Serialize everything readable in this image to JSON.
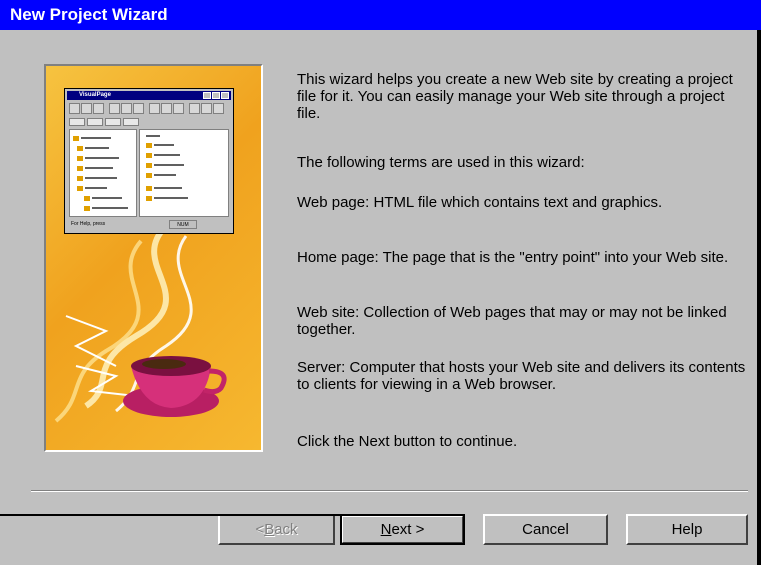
{
  "window": {
    "title": "New Project Wizard"
  },
  "illustration": {
    "mini_app_title": "VisualPage",
    "status_text": "For Help, press",
    "status_box": "NUM"
  },
  "content": {
    "intro": "This wizard helps you create a new Web site by creating a project file for it. You can easily manage your Web site through a project file.",
    "terms_intro": "The following terms are used in this wizard:",
    "term_web_page": "Web page:  HTML file which contains text and graphics.",
    "term_home_page": "Home page:  The page that is the \"entry point\" into your Web site.",
    "term_web_site": "Web site: Collection of Web pages that may or may not be linked together.",
    "term_server": "Server: Computer that hosts your Web site and delivers its contents to clients for viewing in a Web browser.",
    "instruction": "Click the Next button to continue."
  },
  "buttons": {
    "back": {
      "pre": "< ",
      "accel": "B",
      "post": "ack",
      "enabled": false
    },
    "next": {
      "pre": "",
      "accel": "N",
      "post": "ext >"
    },
    "cancel": "Cancel",
    "help": "Help"
  },
  "colors": {
    "titlebar": "#0000ff",
    "face": "#c0c0c0",
    "illustration_bg": "#f0a21e",
    "cup": "#d6307a"
  }
}
